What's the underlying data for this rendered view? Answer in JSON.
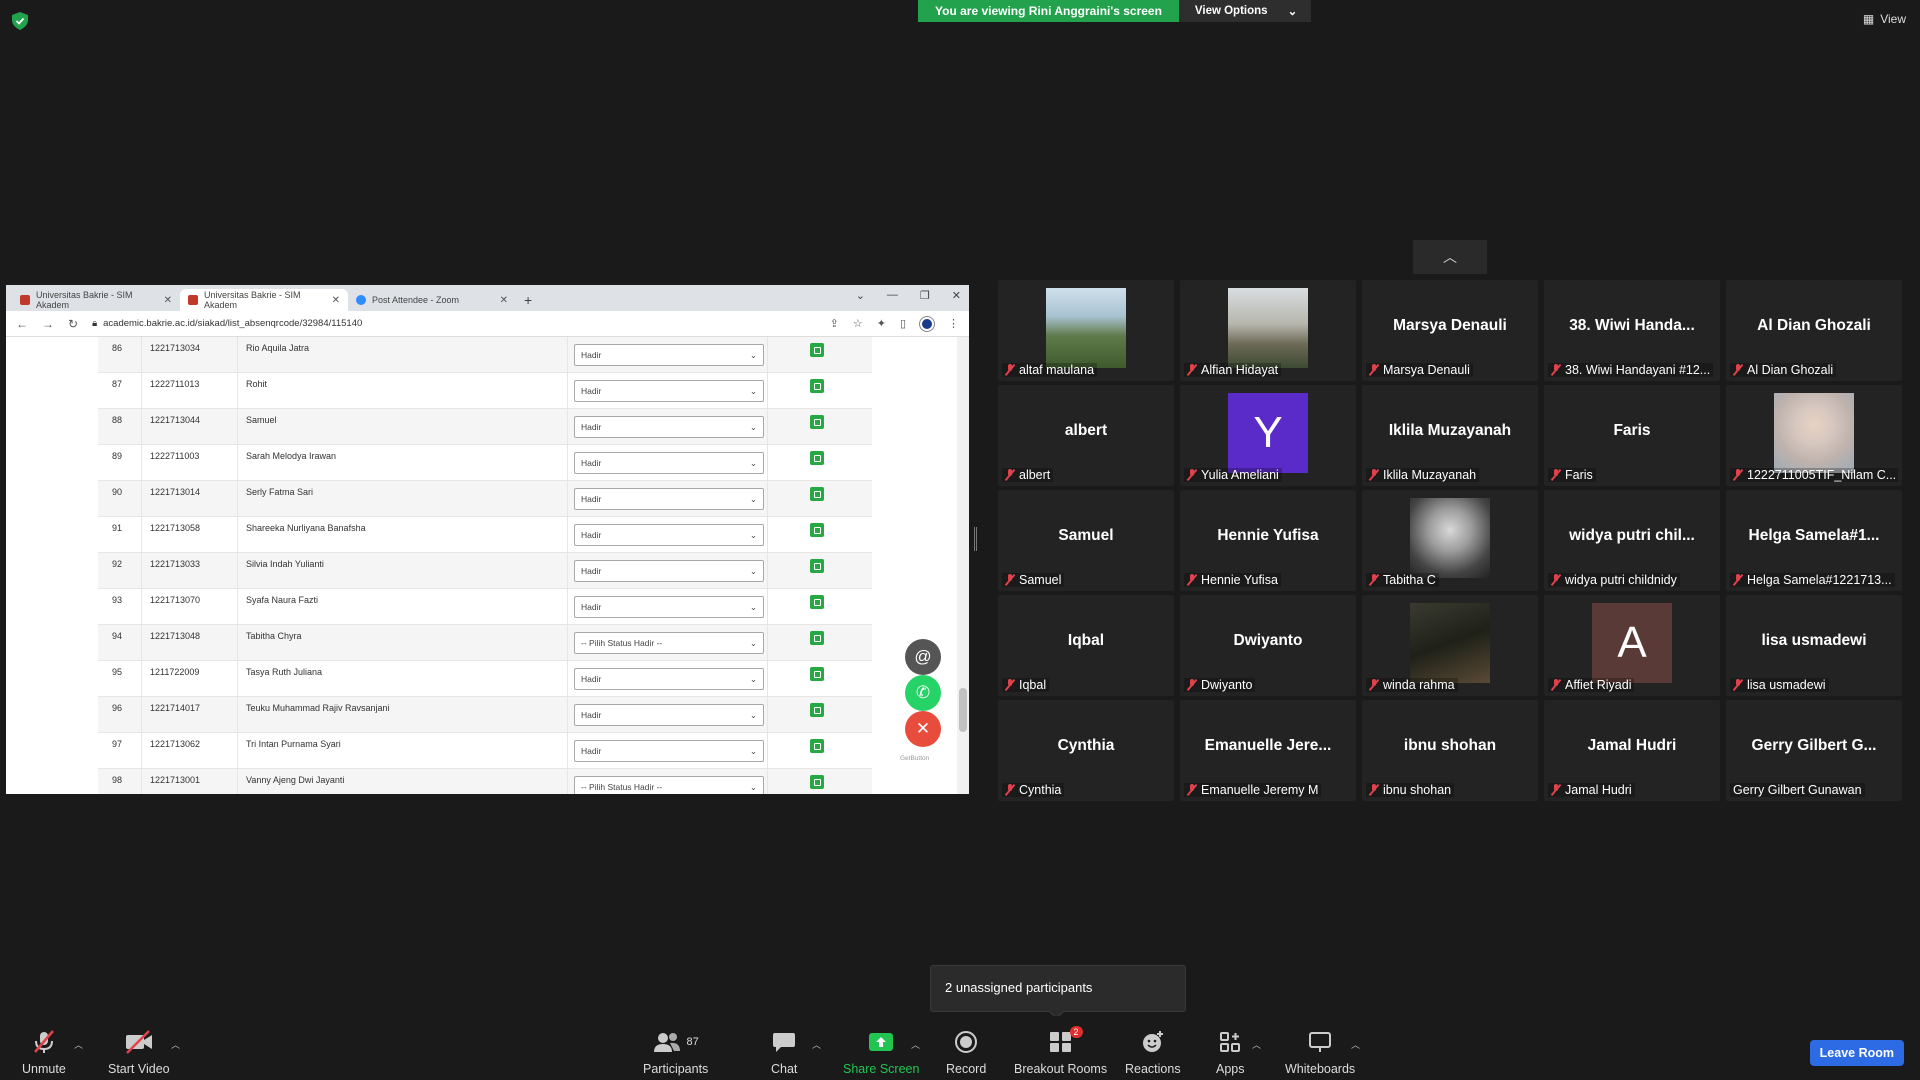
{
  "top": {
    "viewing_banner": "You are viewing Rini Anggraini's screen",
    "view_options": "View Options",
    "view_label": "View"
  },
  "browser": {
    "tabs": [
      {
        "title": "Universitas Bakrie - SIM Akadem",
        "favicon": "university-favicon"
      },
      {
        "title": "Universitas Bakrie - SIM Akadem",
        "favicon": "university-favicon"
      },
      {
        "title": "Post Attendee - Zoom",
        "favicon": "zoom-favicon"
      }
    ],
    "url": "academic.bakrie.ac.id/siakad/list_absenqrcode/32984/115140"
  },
  "attendance": {
    "rows": [
      {
        "no": "86",
        "nim": "1221713034",
        "name": "Rio Aquila Jatra",
        "status": "Hadir"
      },
      {
        "no": "87",
        "nim": "1222711013",
        "name": "Rohit",
        "status": "Hadir"
      },
      {
        "no": "88",
        "nim": "1221713044",
        "name": "Samuel",
        "status": "Hadir"
      },
      {
        "no": "89",
        "nim": "1222711003",
        "name": "Sarah Melodya Irawan",
        "status": "Hadir"
      },
      {
        "no": "90",
        "nim": "1221713014",
        "name": "Serly Fatma Sari",
        "status": "Hadir"
      },
      {
        "no": "91",
        "nim": "1221713058",
        "name": "Shareeka Nurliyana Banafsha",
        "status": "Hadir"
      },
      {
        "no": "92",
        "nim": "1221713033",
        "name": "Silvia Indah Yulianti",
        "status": "Hadir"
      },
      {
        "no": "93",
        "nim": "1221713070",
        "name": "Syafa Naura Fazti",
        "status": "Hadir"
      },
      {
        "no": "94",
        "nim": "1221713048",
        "name": "Tabitha Chyra",
        "status": "-- Pilih Status Hadir --"
      },
      {
        "no": "95",
        "nim": "1211722009",
        "name": "Tasya Ruth Juliana",
        "status": "Hadir"
      },
      {
        "no": "96",
        "nim": "1221714017",
        "name": "Teuku Muhammad Rajiv Ravsanjani",
        "status": "Hadir"
      },
      {
        "no": "97",
        "nim": "1221713062",
        "name": "Tri Intan Purnama Syari",
        "status": "Hadir"
      },
      {
        "no": "98",
        "nim": "1221713001",
        "name": "Vanny Ajeng Dwi Jayanti",
        "status": "-- Pilih Status Hadir --"
      }
    ],
    "getbutton": "GetButton"
  },
  "gallery": {
    "tiles": [
      {
        "big": "",
        "label": "altaf maulana",
        "photo": "outdoor",
        "muted": true
      },
      {
        "big": "",
        "label": "Alfian Hidayat",
        "photo": "temple",
        "muted": true
      },
      {
        "big": "Marsya Denauli",
        "label": "Marsya Denauli",
        "muted": true
      },
      {
        "big": "38. Wiwi Handa...",
        "label": "38. Wiwi Handayani #12...",
        "muted": true
      },
      {
        "big": "Al Dian Ghozali",
        "label": "Al Dian Ghozali",
        "muted": true
      },
      {
        "big": "albert",
        "label": "albert",
        "muted": true
      },
      {
        "big": "",
        "label": "Yulia Ameliani",
        "letter": "Y",
        "letter_color": "#5b2bc9",
        "muted": true
      },
      {
        "big": "Iklila Muzayanah",
        "label": "Iklila Muzayanah",
        "muted": true
      },
      {
        "big": "Faris",
        "label": "Faris",
        "muted": true
      },
      {
        "big": "",
        "label": "1222711005TIF_Nilam C...",
        "photo": "portrait-light",
        "muted": true
      },
      {
        "big": "Samuel",
        "label": "Samuel",
        "muted": true
      },
      {
        "big": "Hennie Yufisa",
        "label": "Hennie Yufisa",
        "muted": true
      },
      {
        "big": "",
        "label": "Tabitha C",
        "photo": "portrait-bw",
        "muted": true
      },
      {
        "big": "widya putri chil...",
        "label": "widya putri childnidy",
        "muted": true
      },
      {
        "big": "Helga Samela#1...",
        "label": "Helga Samela#1221713...",
        "muted": true
      },
      {
        "big": "Iqbal",
        "label": "Iqbal",
        "muted": true
      },
      {
        "big": "Dwiyanto",
        "label": "Dwiyanto",
        "muted": true
      },
      {
        "big": "",
        "label": "winda rahma",
        "photo": "dark-scene",
        "muted": true
      },
      {
        "big": "",
        "label": "Affiet Riyadi",
        "letter": "A",
        "letter_color": "#5a3a36",
        "muted": true
      },
      {
        "big": "lisa usmadewi",
        "label": "lisa usmadewi",
        "muted": true
      },
      {
        "big": "Cynthia",
        "label": "Cynthia",
        "muted": true
      },
      {
        "big": "Emanuelle Jere...",
        "label": "Emanuelle Jeremy M",
        "muted": true
      },
      {
        "big": "ibnu shohan",
        "label": "ibnu shohan",
        "muted": true
      },
      {
        "big": "Jamal Hudri",
        "label": "Jamal Hudri",
        "muted": true
      },
      {
        "big": "Gerry Gilbert G...",
        "label": "Gerry Gilbert Gunawan",
        "muted": false
      }
    ]
  },
  "popover": {
    "text": "2 unassigned participants"
  },
  "toolbar": {
    "unmute": "Unmute",
    "start_video": "Start Video",
    "participants": "Participants",
    "participants_count": "87",
    "chat": "Chat",
    "share_screen": "Share Screen",
    "record": "Record",
    "breakout_rooms": "Breakout Rooms",
    "breakout_badge": "2",
    "reactions": "Reactions",
    "apps": "Apps",
    "whiteboards": "Whiteboards",
    "leave_room": "Leave Room"
  }
}
